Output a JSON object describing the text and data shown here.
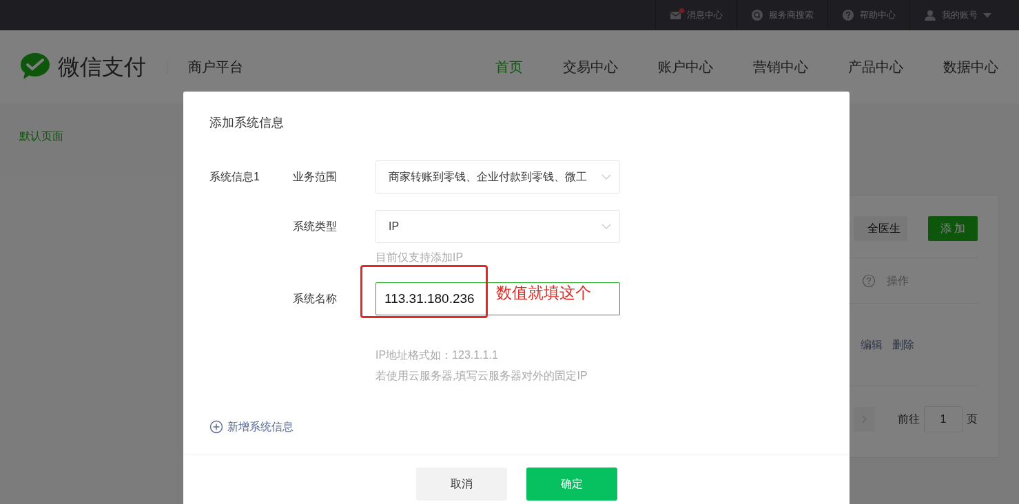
{
  "top_bar": {
    "links": [
      {
        "label": "消息中心",
        "unread": true
      },
      {
        "label": "服务商搜索",
        "unread": false
      },
      {
        "label": "帮助中心",
        "unread": false
      },
      {
        "label": "我的账号",
        "unread": false
      }
    ]
  },
  "header": {
    "logo_text": "微信支付",
    "platform": "商户平台",
    "nav": [
      {
        "label": "首页",
        "selected": true
      },
      {
        "label": "交易中心",
        "selected": false
      },
      {
        "label": "账户中心",
        "selected": false
      },
      {
        "label": "营销中心",
        "selected": false
      },
      {
        "label": "产品中心",
        "selected": false
      },
      {
        "label": "数据中心",
        "selected": false
      }
    ]
  },
  "sidebar": {
    "items": [
      {
        "label": "默认页面",
        "selected": true
      }
    ]
  },
  "card": {
    "buttons": [
      {
        "label": "全医生",
        "kind": "secondary"
      },
      {
        "label": "添 加",
        "kind": "primary"
      }
    ],
    "table_header": "操作",
    "row_actions": [
      "编辑",
      "删除"
    ],
    "pagination": {
      "goto_label": "前往",
      "page": "1",
      "page_suffix": "页"
    }
  },
  "dialog": {
    "title": "添加系统信息",
    "group_label": "系统信息1",
    "fields": [
      {
        "kind": "select",
        "label": "业务范围",
        "value": "商家转账到零钱、企业付款到零钱、微工",
        "focused": false
      },
      {
        "kind": "select",
        "label": "系统类型",
        "value": "IP",
        "focused": false,
        "hints": [
          "目前仅支持添加IP"
        ]
      },
      {
        "kind": "input",
        "label": "系统名称",
        "value": "113.31.180.236",
        "focused": true,
        "hints": [
          "IP地址格式如：123.1.1.1",
          "若使用云服务器,填写云服务器对外的固定IP"
        ]
      }
    ],
    "add_link": "新增系统信息",
    "buttons": [
      {
        "label": "取消",
        "kind": "secondary"
      },
      {
        "label": "确定",
        "kind": "primary"
      }
    ]
  },
  "annotation": {
    "text": "数值就填这个"
  }
}
